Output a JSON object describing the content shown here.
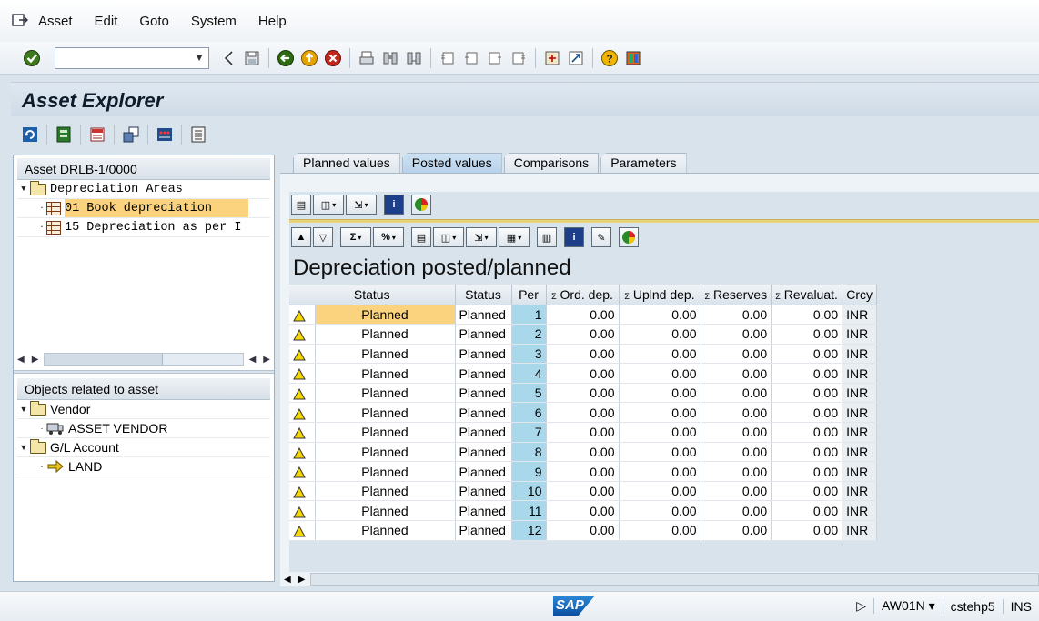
{
  "menu": {
    "items": [
      {
        "label": "Asset"
      },
      {
        "label": "Edit"
      },
      {
        "label": "Goto"
      },
      {
        "label": "System"
      },
      {
        "label": "Help"
      }
    ]
  },
  "command_field": {
    "value": ""
  },
  "title": "Asset Explorer",
  "left_tree": {
    "header": "Asset DRLB-1/0000",
    "root": "Depreciation Areas",
    "areas": [
      {
        "label": "01 Book depreciation",
        "selected": true
      },
      {
        "label": "15 Depreciation as per I"
      }
    ]
  },
  "related": {
    "header": "Objects related to asset",
    "vendor_folder": "Vendor",
    "vendor": "ASSET VENDOR",
    "gl_folder": "G/L Account",
    "gl_account": "LAND"
  },
  "tabs": [
    {
      "label": "Planned values"
    },
    {
      "label": "Posted values",
      "active": true
    },
    {
      "label": "Comparisons"
    },
    {
      "label": "Parameters"
    }
  ],
  "report": {
    "title": "Depreciation posted/planned",
    "columns": {
      "status_icon": "Status",
      "status": "Status",
      "per": "Per",
      "ord_dep": "Ord. dep.",
      "uplnd_dep": "Uplnd dep.",
      "reserves": "Reserves",
      "revaluat": "Revaluat.",
      "crcy": "Crcy"
    },
    "rows": [
      {
        "status1": "Planned",
        "status2": "Planned",
        "per": "1",
        "ord": "0.00",
        "uplnd": "0.00",
        "res": "0.00",
        "reval": "0.00",
        "crcy": "INR"
      },
      {
        "status1": "Planned",
        "status2": "Planned",
        "per": "2",
        "ord": "0.00",
        "uplnd": "0.00",
        "res": "0.00",
        "reval": "0.00",
        "crcy": "INR"
      },
      {
        "status1": "Planned",
        "status2": "Planned",
        "per": "3",
        "ord": "0.00",
        "uplnd": "0.00",
        "res": "0.00",
        "reval": "0.00",
        "crcy": "INR"
      },
      {
        "status1": "Planned",
        "status2": "Planned",
        "per": "4",
        "ord": "0.00",
        "uplnd": "0.00",
        "res": "0.00",
        "reval": "0.00",
        "crcy": "INR"
      },
      {
        "status1": "Planned",
        "status2": "Planned",
        "per": "5",
        "ord": "0.00",
        "uplnd": "0.00",
        "res": "0.00",
        "reval": "0.00",
        "crcy": "INR"
      },
      {
        "status1": "Planned",
        "status2": "Planned",
        "per": "6",
        "ord": "0.00",
        "uplnd": "0.00",
        "res": "0.00",
        "reval": "0.00",
        "crcy": "INR"
      },
      {
        "status1": "Planned",
        "status2": "Planned",
        "per": "7",
        "ord": "0.00",
        "uplnd": "0.00",
        "res": "0.00",
        "reval": "0.00",
        "crcy": "INR"
      },
      {
        "status1": "Planned",
        "status2": "Planned",
        "per": "8",
        "ord": "0.00",
        "uplnd": "0.00",
        "res": "0.00",
        "reval": "0.00",
        "crcy": "INR"
      },
      {
        "status1": "Planned",
        "status2": "Planned",
        "per": "9",
        "ord": "0.00",
        "uplnd": "0.00",
        "res": "0.00",
        "reval": "0.00",
        "crcy": "INR"
      },
      {
        "status1": "Planned",
        "status2": "Planned",
        "per": "10",
        "ord": "0.00",
        "uplnd": "0.00",
        "res": "0.00",
        "reval": "0.00",
        "crcy": "INR"
      },
      {
        "status1": "Planned",
        "status2": "Planned",
        "per": "11",
        "ord": "0.00",
        "uplnd": "0.00",
        "res": "0.00",
        "reval": "0.00",
        "crcy": "INR"
      },
      {
        "status1": "Planned",
        "status2": "Planned",
        "per": "12",
        "ord": "0.00",
        "uplnd": "0.00",
        "res": "0.00",
        "reval": "0.00",
        "crcy": "INR"
      }
    ]
  },
  "statusbar": {
    "logo_text": "SAP",
    "transaction": "AW01N",
    "server": "cstehp5",
    "mode": "INS"
  },
  "colors": {
    "selection": "#fbd37e",
    "period_column": "#a8d8ea",
    "background": "#d9e3ec",
    "warning_icon": "#f5d800"
  }
}
